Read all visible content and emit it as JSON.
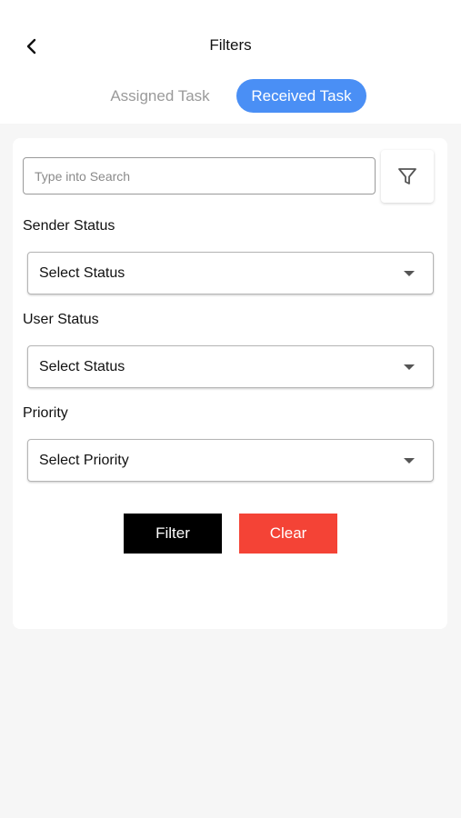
{
  "header": {
    "title": "Filters",
    "back_icon": "chevron-left-icon"
  },
  "tabs": [
    {
      "label": "Assigned Task",
      "active": false
    },
    {
      "label": "Received Task",
      "active": true
    }
  ],
  "colors": {
    "accent": "#4a8ff5",
    "filter_button": "#000000",
    "clear_button": "#f44336"
  },
  "search": {
    "placeholder": "Type into Search",
    "value": "",
    "filter_icon": "funnel-icon"
  },
  "fields": {
    "sender_status": {
      "label": "Sender Status",
      "value": "Select Status"
    },
    "user_status": {
      "label": "User Status",
      "value": "Select Status"
    },
    "priority": {
      "label": "Priority",
      "value": "Select Priority"
    }
  },
  "actions": {
    "filter_label": "Filter",
    "clear_label": "Clear"
  }
}
